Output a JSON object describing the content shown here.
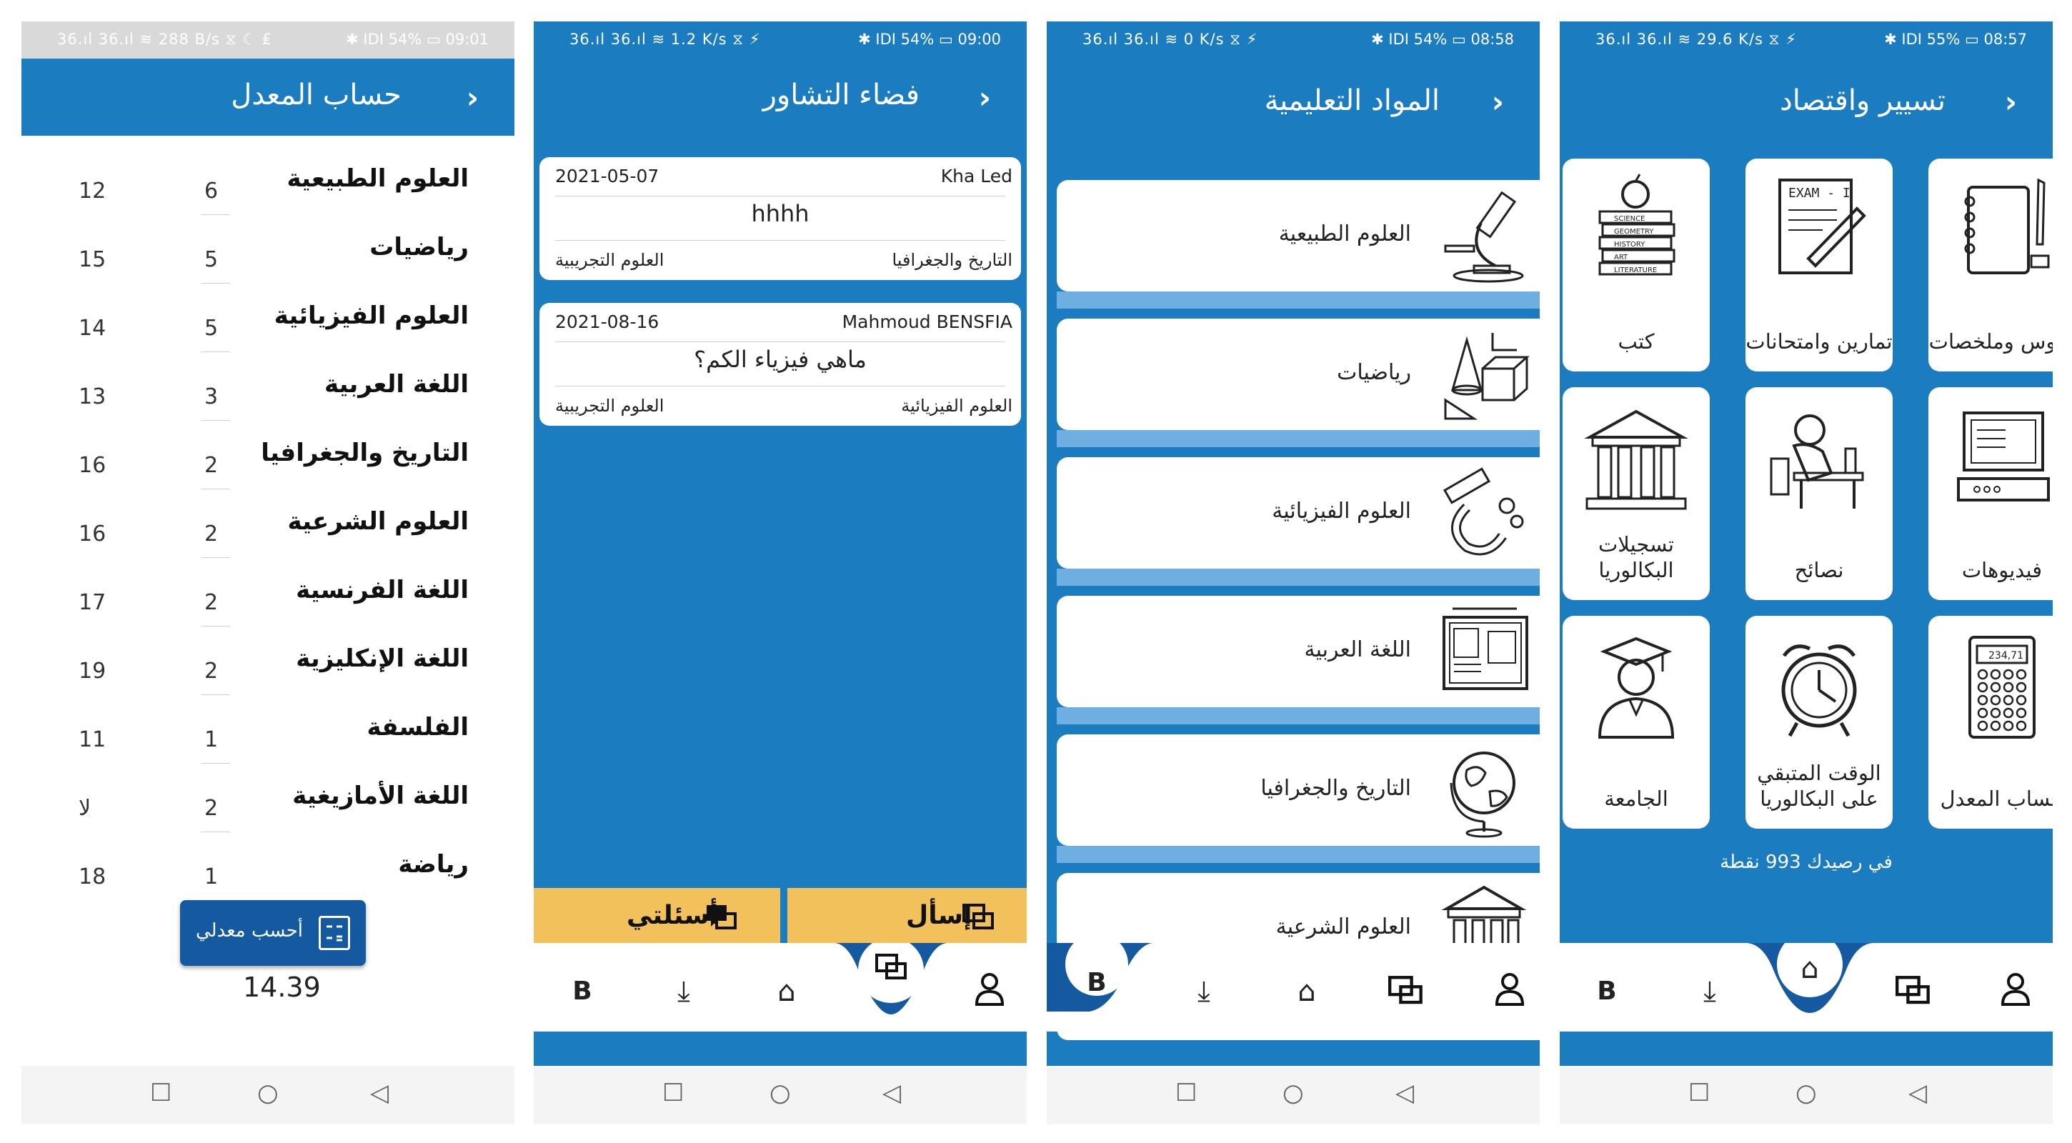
{
  "colors": {
    "primary": "#1b7cc0",
    "dark_blue": "#155aa0",
    "accent_yellow": "#f3c15b",
    "white": "#ffffff"
  },
  "screen1": {
    "status": {
      "left": "36.ıl 36.ıl ≋ 288 B/s ⧖ ☾ ₤",
      "right": "✱ ⅠDⅠ 54% ▭ 09:01"
    },
    "header": {
      "title": "حساب المعدل",
      "back_icon": "chevron-right-icon"
    },
    "rows": [
      {
        "name": "العلوم الطبيعية",
        "coef": "6",
        "grade": "12"
      },
      {
        "name": "رياضيات",
        "coef": "5",
        "grade": "15"
      },
      {
        "name": "العلوم الفيزيائية",
        "coef": "5",
        "grade": "14"
      },
      {
        "name": "اللغة العربية",
        "coef": "3",
        "grade": "13"
      },
      {
        "name": "التاريخ والجغرافيا",
        "coef": "2",
        "grade": "16"
      },
      {
        "name": "العلوم الشرعية",
        "coef": "2",
        "grade": "16"
      },
      {
        "name": "اللغة الفرنسية",
        "coef": "2",
        "grade": "17"
      },
      {
        "name": "اللغة الإنكليزية",
        "coef": "2",
        "grade": "19"
      },
      {
        "name": "الفلسفة",
        "coef": "1",
        "grade": "11"
      },
      {
        "name": "اللغة الأمازيغية",
        "coef": "2",
        "grade": "لا"
      },
      {
        "name": "رياضة",
        "coef": "1",
        "grade": "18"
      }
    ],
    "calc_button": "أحسب معدلي",
    "average": "14.39"
  },
  "screen2": {
    "status": {
      "left": "36.ıl 36.ıl ≋ 1.2 K/s ⧖ ⚡",
      "right": "✱ ⅠDⅠ 54% ▭ 09:00"
    },
    "header": {
      "title": "فضاء التشاور"
    },
    "posts": [
      {
        "date": "2021-05-07",
        "user": "Kha Led",
        "question": "hhhh",
        "subject_left": "العلوم التجريبية",
        "subject_right": "التاريخ والجغرافيا"
      },
      {
        "date": "2021-08-16",
        "user": "Mahmoud BENSFIA",
        "question": "ماهي فيزياء الكم؟",
        "subject_left": "العلوم التجريبية",
        "subject_right": "العلوم الفيزيائية"
      }
    ],
    "my_questions": "أسئلتي",
    "ask": "إسأل",
    "nav_b": "B"
  },
  "screen3": {
    "status": {
      "left": "36.ıl 36.ıl ≋ 0 K/s ⧖ ⚡",
      "right": "✱ ⅠDⅠ 54% ▭ 08:58"
    },
    "header": {
      "title": "المواد التعليمية"
    },
    "subjects": [
      {
        "name": "العلوم الطبيعية",
        "icon": "microscope-icon"
      },
      {
        "name": "رياضيات",
        "icon": "geometry-shapes-icon"
      },
      {
        "name": "العلوم الفيزيائية",
        "icon": "magnet-icon"
      },
      {
        "name": "اللغة العربية",
        "icon": "board-icon"
      },
      {
        "name": "التاريخ والجغرافيا",
        "icon": "globe-icon"
      },
      {
        "name": "العلوم الشرعية",
        "icon": "building-icon"
      }
    ],
    "nav_b": "B"
  },
  "screen4": {
    "status": {
      "left": "36.ıl 36.ıl ≋ 29.6 K/s ⧖ ⚡",
      "right": "✱ ⅠDⅠ 55% ▭ 08:57"
    },
    "header": {
      "title": "تسيير واقتصاد"
    },
    "tiles": [
      {
        "name": "دروس وملخصات",
        "icon": "notebook-icon"
      },
      {
        "name": "تمارين وامتحانات",
        "icon": "exam-paper-icon"
      },
      {
        "name": "كتب",
        "icon": "books-icon"
      },
      {
        "name": "فيديوهات",
        "icon": "computer-icon"
      },
      {
        "name": "نصائح",
        "icon": "student-desk-icon"
      },
      {
        "name": "تسجيلات البكالوريا",
        "icon": "institution-icon"
      },
      {
        "name": "حساب المعدل",
        "icon": "calculator-icon"
      },
      {
        "name": "الوقت المتبقي على البكالوريا",
        "icon": "alarm-clock-icon"
      },
      {
        "name": "الجامعة",
        "icon": "graduate-icon"
      }
    ],
    "exam_text": "EXAM - I",
    "calculator_display": "234,71",
    "book_labels": [
      "SCIENCE",
      "GEOMETRY",
      "HISTORY",
      "ART",
      "LITERATURE"
    ],
    "balance": "في رصيدك 993 نقطة",
    "nav_b": "B"
  }
}
